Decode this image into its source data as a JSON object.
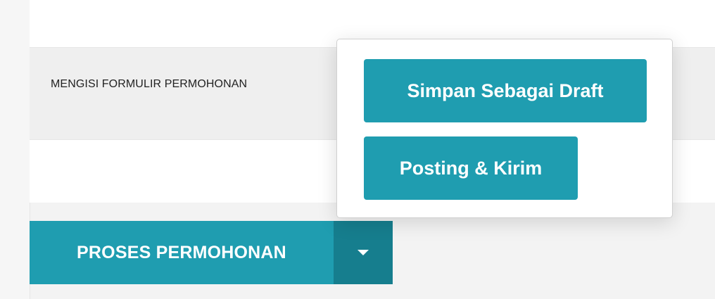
{
  "info": {
    "label": "MENGISI FORMULIR PERMOHONAN"
  },
  "actions": {
    "main_label": "PROSES PERMOHONAN",
    "caret_icon": "caret-down-icon"
  },
  "dropdown": {
    "items": [
      {
        "label": "Simpan Sebagai Draft"
      },
      {
        "label": "Posting & Kirim"
      }
    ]
  },
  "colors": {
    "primary": "#1f9db0",
    "primary_dark": "#167e8e"
  }
}
